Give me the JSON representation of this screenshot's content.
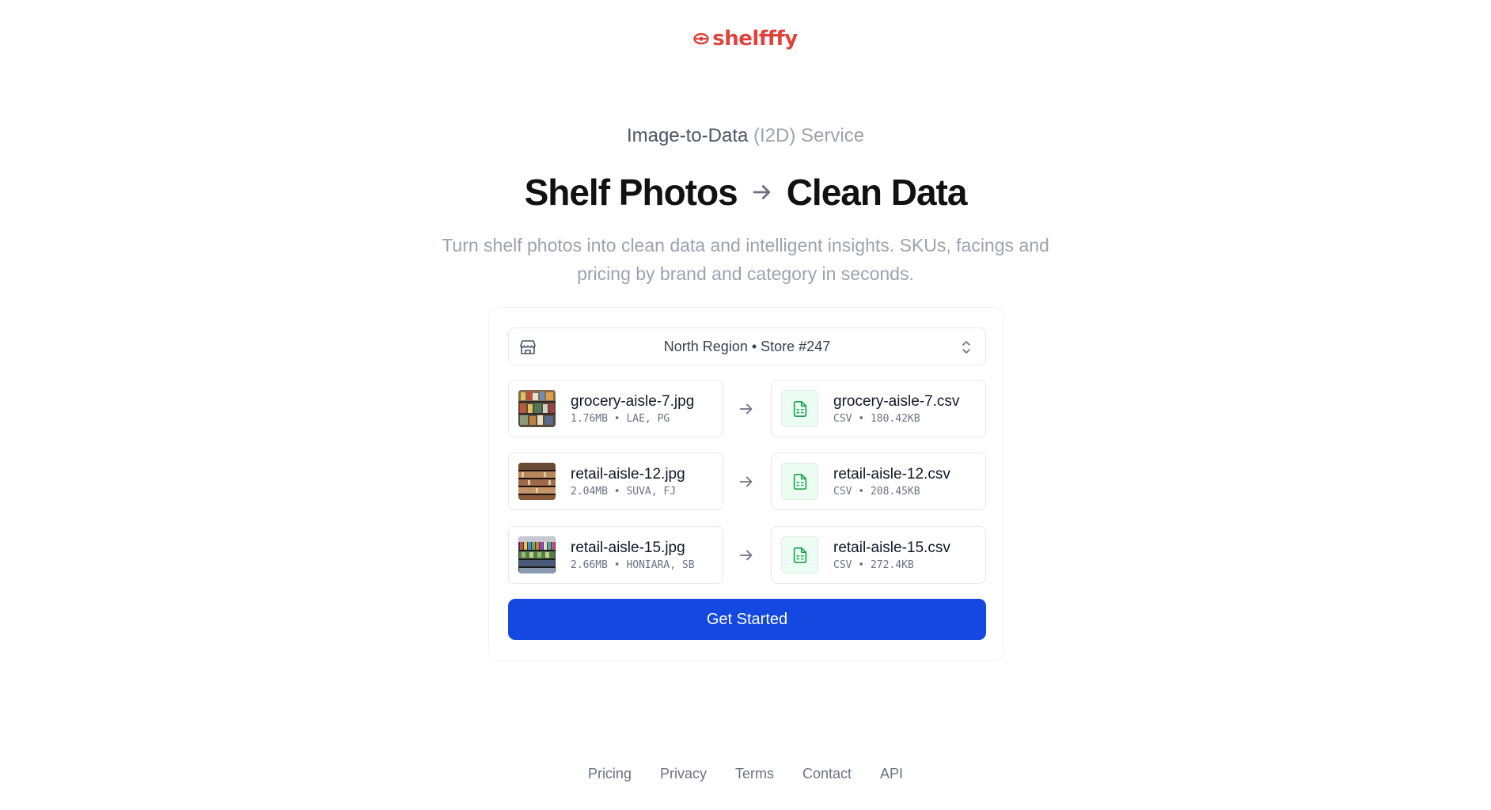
{
  "brand": {
    "name": "shelfffy",
    "color": "#e0423b"
  },
  "hero": {
    "eyebrow_main": "Image-to-Data",
    "eyebrow_suffix": "(I2D) Service",
    "headline_left": "Shelf Photos",
    "headline_right": "Clean Data",
    "subtext": "Turn shelf photos into clean data and intelligent insights. SKUs, facings and pricing by brand and category in seconds."
  },
  "store_selector": {
    "value": "North Region • Store #247",
    "icon": "store-icon",
    "chevron": "chevron-up-down-icon"
  },
  "conversions": [
    {
      "source_name": "grocery-aisle-7.jpg",
      "source_meta": "1.76MB • LAE, PG",
      "output_name": "grocery-aisle-7.csv",
      "output_meta": "CSV • 180.42KB"
    },
    {
      "source_name": "retail-aisle-12.jpg",
      "source_meta": "2.04MB • SUVA, FJ",
      "output_name": "retail-aisle-12.csv",
      "output_meta": "CSV • 208.45KB"
    },
    {
      "source_name": "retail-aisle-15.jpg",
      "source_meta": "2.66MB • HONIARA, SB",
      "output_name": "retail-aisle-15.csv",
      "output_meta": "CSV • 272.4KB"
    }
  ],
  "cta": {
    "label": "Get Started",
    "color": "#1448e0"
  },
  "footer": {
    "links": [
      "Pricing",
      "Privacy",
      "Terms",
      "Contact",
      "API"
    ]
  }
}
